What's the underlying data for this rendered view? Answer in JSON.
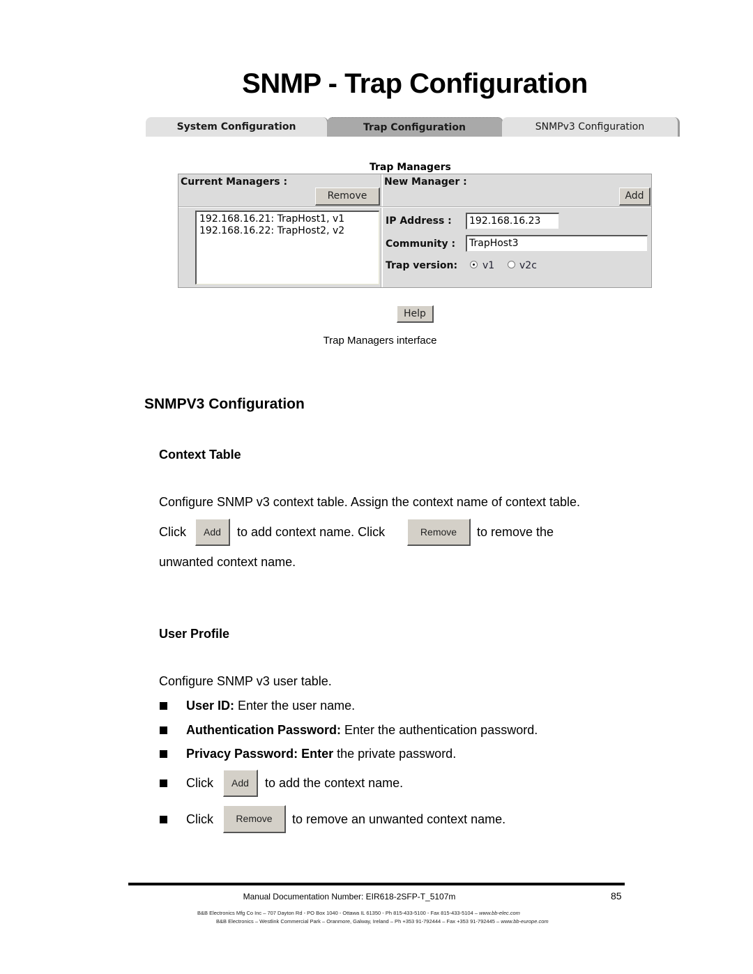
{
  "screenshot": {
    "title": "SNMP - Trap Configuration",
    "tabs": [
      {
        "label": "System Configuration",
        "active": false
      },
      {
        "label": "Trap Configuration",
        "active": true
      },
      {
        "label": "SNMPv3 Configuration",
        "active": false
      }
    ],
    "panel_caption": "Trap Managers",
    "current_managers": {
      "label": "Current Managers :",
      "remove_label": "Remove",
      "items": [
        "192.168.16.21: TrapHost1, v1",
        "192.168.16.22: TrapHost2, v2"
      ]
    },
    "new_manager": {
      "label": "New Manager :",
      "add_label": "Add",
      "ip_label": "IP Address :",
      "ip_value": "192.168.16.23",
      "community_label": "Community :",
      "community_value": "TrapHost3",
      "trap_version_label": "Trap version:",
      "versions": [
        {
          "label": "v1",
          "selected": true
        },
        {
          "label": "v2c",
          "selected": false
        }
      ]
    },
    "help_label": "Help"
  },
  "figure_caption": "Trap Managers interface",
  "section": {
    "title": "SNMPV3 Configuration",
    "context_table": {
      "heading": "Context Table",
      "line1": "Configure SNMP v3 context table. Assign the context name of context table.",
      "click1": "Click",
      "add_label": "Add",
      "mid": "to add context name. Click",
      "remove_label": "Remove",
      "tail": "to remove the",
      "line3": "unwanted context name."
    },
    "user_profile": {
      "heading": "User Profile",
      "intro": "Configure SNMP v3 user table.",
      "bullets": [
        {
          "bold": "User ID:",
          "text": " Enter the user name."
        },
        {
          "bold": "Authentication Password:",
          "text": " Enter the authentication password."
        },
        {
          "bold": "Privacy Password: Enter",
          "text": " the private password."
        }
      ],
      "click_add": {
        "pre": "Click",
        "button": "Add",
        "post": "to add the context name."
      },
      "click_remove": {
        "pre": "Click",
        "button": "Remove",
        "post": "to remove an unwanted context name."
      }
    }
  },
  "footer": {
    "doc_number": "Manual Documentation Number: EIR618-2SFP-T_5107m",
    "page_number": "85",
    "address1": "B&B Electronics Mfg Co Inc – 707 Dayton Rd - PO Box 1040 - Ottawa IL 61350 - Ph 815-433-5100 - Fax 815-433-5104 – ",
    "url1": "www.bb-elec.com",
    "address2": "B&B Electronics – Westlink Commercial Park – Oranmore, Galway, Ireland – Ph +353 91-792444 – Fax +353 91-792445 – ",
    "url2": "www.bb-europe.com"
  }
}
